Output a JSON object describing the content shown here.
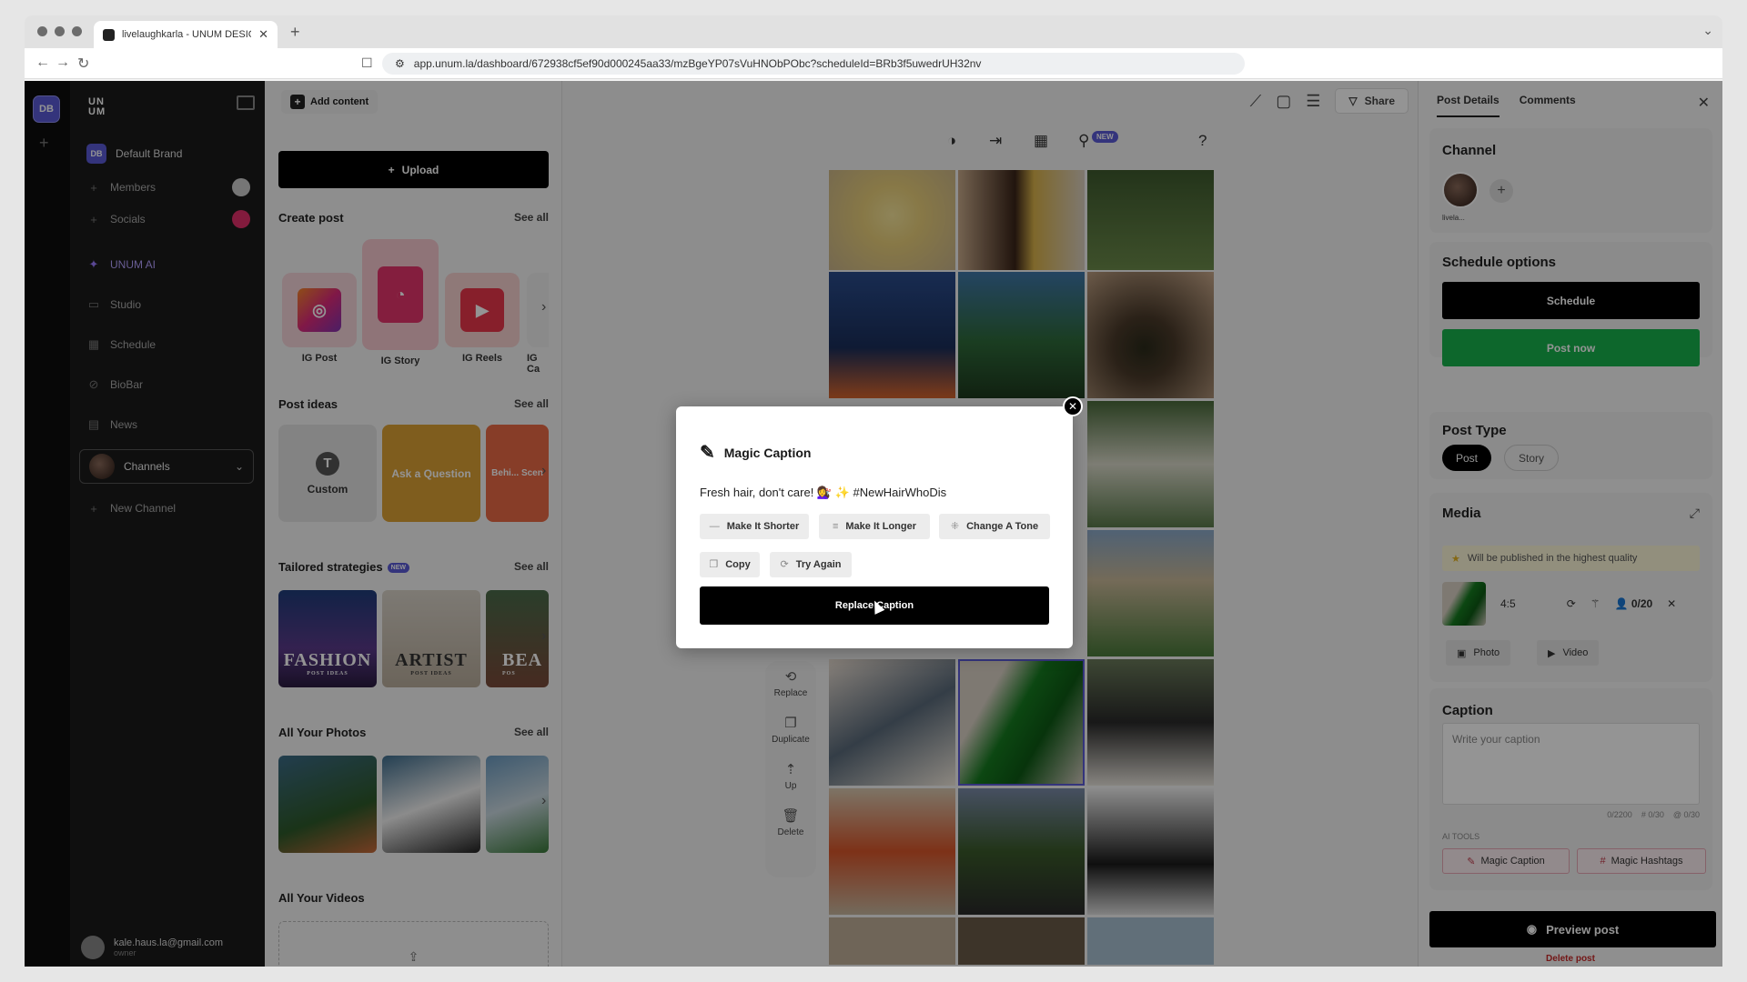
{
  "browser": {
    "tab_title": "livelaughkarla - UNUM DESIG",
    "url": "app.unum.la/dashboard/672938cf5ef90d000245aa33/mzBgeYP07sVuHNObPObc?scheduleId=BRb3f5uwedrUH32nv"
  },
  "rail": {
    "workspace_badge": "DB"
  },
  "sidebar": {
    "logo": "UN UM",
    "brand_badge": "DB",
    "brand_name": "Default Brand",
    "items": [
      {
        "label": "Members"
      },
      {
        "label": "Socials"
      },
      {
        "label": "UNUM AI"
      },
      {
        "label": "Studio"
      },
      {
        "label": "Schedule"
      },
      {
        "label": "BioBar"
      },
      {
        "label": "News"
      }
    ],
    "channels_label": "Channels",
    "new_channel_label": "New Channel",
    "user_email": "kale.haus.la@gmail.com",
    "user_role": "owner"
  },
  "left_panel": {
    "add_content": "Add content",
    "upload": "Upload",
    "create_post": {
      "title": "Create post",
      "see_all": "See all",
      "items": [
        "IG Post",
        "IG Story",
        "IG Reels",
        "IG Ca"
      ]
    },
    "post_ideas": {
      "title": "Post ideas",
      "see_all": "See all",
      "items": [
        "Custom",
        "Ask a Question",
        "Behi... Scen"
      ],
      "custom_glyph": "T"
    },
    "tailored": {
      "title": "Tailored strategies",
      "badge": "NEW",
      "see_all": "See all",
      "items": [
        {
          "big": "FASHION",
          "small": "POST IDEAS"
        },
        {
          "big": "ARTIST",
          "small": "POST IDEAS"
        },
        {
          "big": "BEA",
          "small": "POS"
        }
      ]
    },
    "all_photos": {
      "title": "All Your Photos",
      "see_all": "See all"
    },
    "all_videos": {
      "title": "All Your Videos"
    }
  },
  "canvas": {
    "share": "Share",
    "new_badge": "NEW",
    "side_tools": [
      "Replace",
      "Duplicate",
      "Up",
      "Delete"
    ]
  },
  "right_panel": {
    "tabs": [
      "Post Details",
      "Comments"
    ],
    "channel": {
      "title": "Channel",
      "account": "livela..."
    },
    "schedule": {
      "title": "Schedule options",
      "schedule_btn": "Schedule",
      "post_now_btn": "Post now"
    },
    "post_type": {
      "title": "Post Type",
      "options": [
        "Post",
        "Story"
      ],
      "selected": "Post"
    },
    "media": {
      "title": "Media",
      "notice": "Will be published in the highest quality",
      "ratio": "4:5",
      "tag_count": "0/20",
      "photo_btn": "Photo",
      "video_btn": "Video"
    },
    "caption": {
      "title": "Caption",
      "placeholder": "Write your caption",
      "char_count": "0/2200",
      "hashtag_count": "# 0/30",
      "mention_count": "@ 0/30",
      "ai_tools_label": "AI TOOLS",
      "magic_caption": "Magic Caption",
      "magic_hashtags": "Magic Hashtags"
    },
    "preview_btn": "Preview post",
    "delete_post": "Delete post"
  },
  "modal": {
    "title": "Magic Caption",
    "caption_text": "Fresh hair, don't care! 💇‍♀️ ✨ #NewHairWhoDis",
    "make_shorter": "Make It Shorter",
    "make_longer": "Make It Longer",
    "change_tone": "Change A Tone",
    "copy": "Copy",
    "try_again": "Try Again",
    "replace_caption": "Replace Caption"
  }
}
